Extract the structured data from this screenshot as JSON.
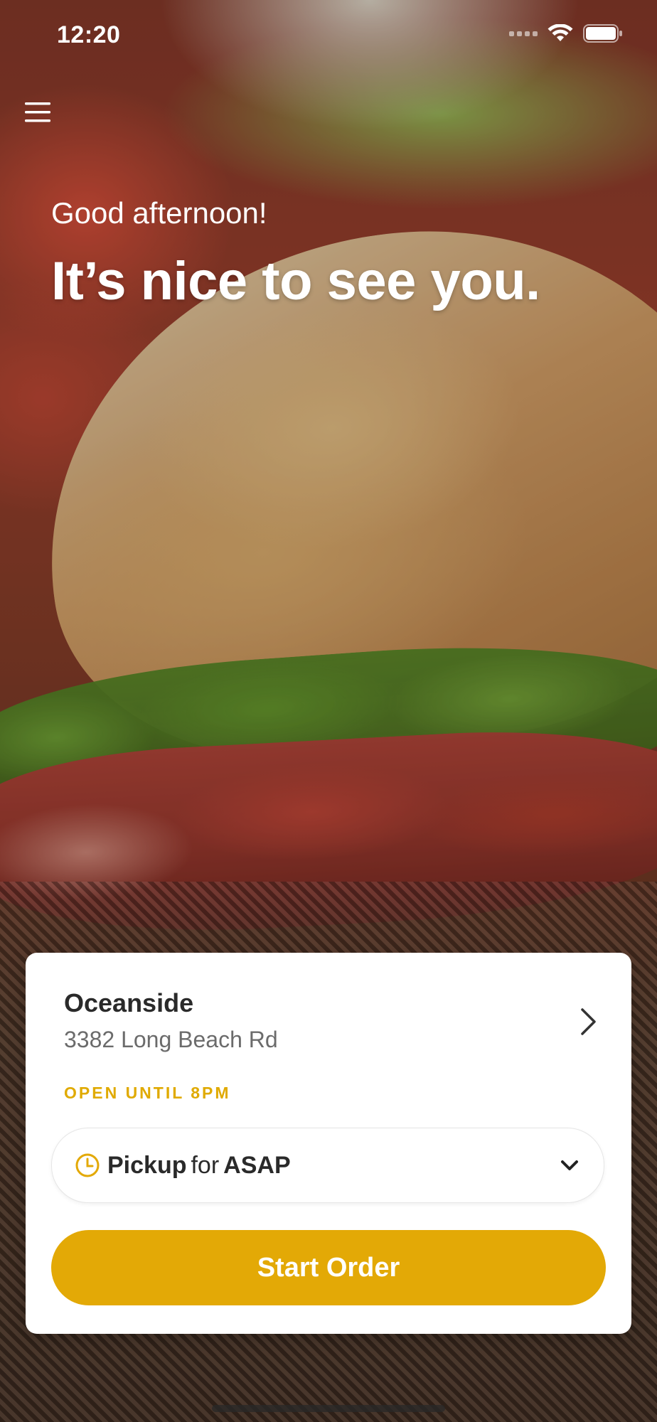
{
  "status_bar": {
    "time": "12:20"
  },
  "header": {
    "menu_icon": "hamburger-menu-icon",
    "greeting": "Good afternoon!",
    "headline": "It’s nice to see you."
  },
  "store_card": {
    "name": "Oceanside",
    "address": "3382 Long Beach Rd",
    "open_status": "OPEN UNTIL 8PM",
    "order_mode": "Pickup",
    "order_connector": "for",
    "order_time": "ASAP",
    "start_button_label": "Start Order"
  },
  "colors": {
    "accent": "#E3A906",
    "open_status": "#E0AA00",
    "text_dark": "#2A2A2A",
    "text_muted": "#6B6B6B"
  }
}
